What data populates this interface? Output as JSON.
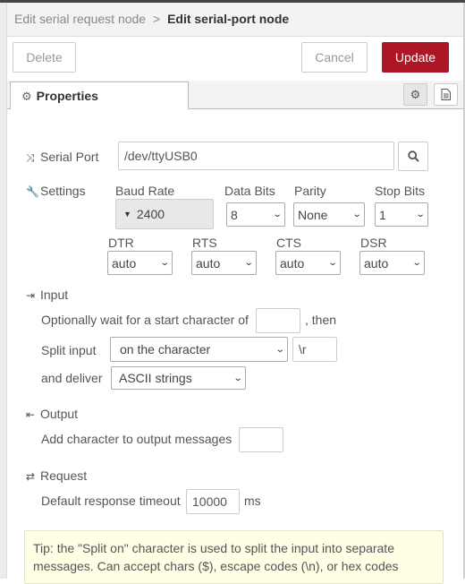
{
  "breadcrumb": {
    "parent": "Edit serial request node",
    "separator": ">",
    "current": "Edit serial-port node"
  },
  "toolbar": {
    "delete_label": "Delete",
    "cancel_label": "Cancel",
    "update_label": "Update"
  },
  "tabs": {
    "properties_label": "Properties"
  },
  "serial_port": {
    "label": "Serial Port",
    "value": "/dev/ttyUSB0"
  },
  "settings": {
    "label": "Settings",
    "baud_rate": {
      "label": "Baud Rate",
      "value": "2400"
    },
    "data_bits": {
      "label": "Data Bits",
      "value": "8"
    },
    "parity": {
      "label": "Parity",
      "value": "None"
    },
    "stop_bits": {
      "label": "Stop Bits",
      "value": "1"
    },
    "dtr": {
      "label": "DTR",
      "value": "auto"
    },
    "rts": {
      "label": "RTS",
      "value": "auto"
    },
    "cts": {
      "label": "CTS",
      "value": "auto"
    },
    "dsr": {
      "label": "DSR",
      "value": "auto"
    }
  },
  "input": {
    "heading": "Input",
    "wait_label": "Optionally wait for a start character of",
    "wait_value": "",
    "then_label": ", then",
    "split_label": "Split input",
    "split_value": "on the character",
    "split_char": "\\r",
    "deliver_label": "and deliver",
    "deliver_value": "ASCII strings"
  },
  "output": {
    "heading": "Output",
    "add_char_label": "Add character to output messages",
    "add_char_value": ""
  },
  "request": {
    "heading": "Request",
    "timeout_label": "Default response timeout",
    "timeout_value": "10000",
    "timeout_unit": "ms"
  },
  "tip": {
    "text_line1": "Tip: the \"Split on\" character is used to split the input into separate",
    "text_line2": "messages. Can accept chars ($), escape codes (\\n), or hex codes"
  },
  "colors": {
    "primary": "#ad1625",
    "tip_background": "#ffffe6"
  }
}
